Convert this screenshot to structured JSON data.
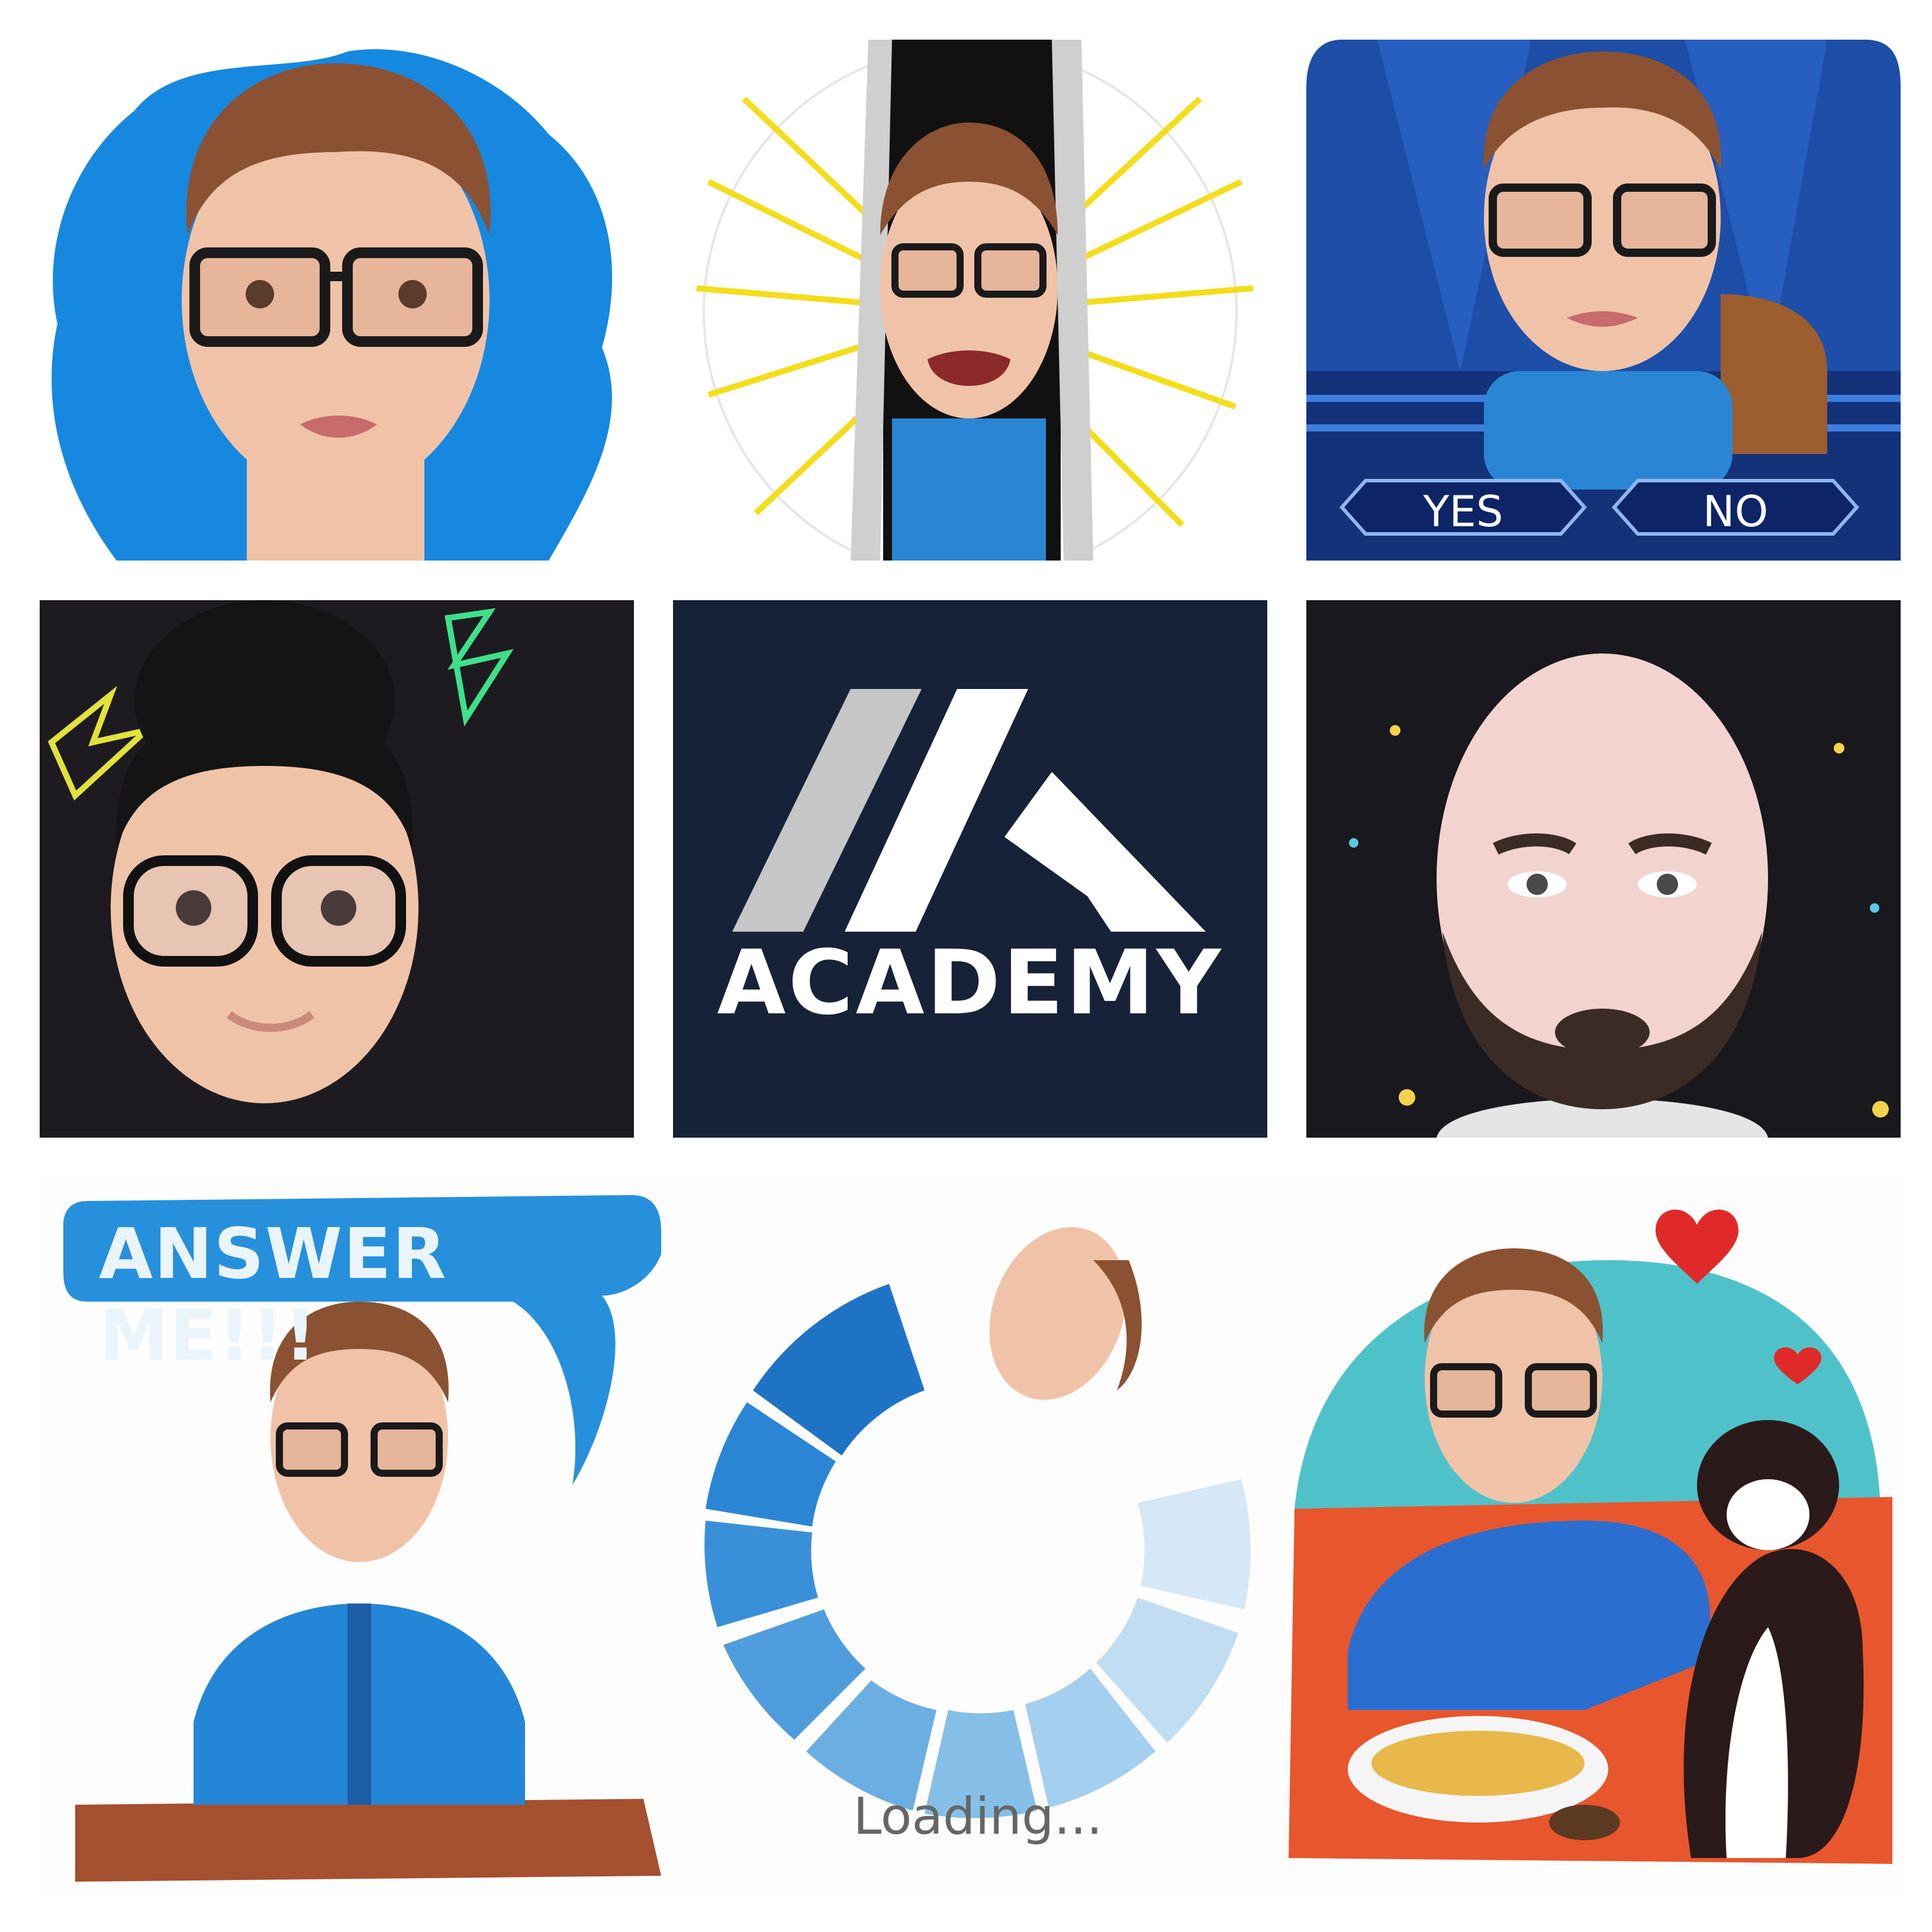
{
  "tiles": {
    "quiz": {
      "yes_label": "YES",
      "no_label": "NO"
    },
    "logo": {
      "text": "ACADEMY"
    },
    "answer": {
      "bubble_text": "ANSWER ME!!!"
    },
    "loading": {
      "text": "Loading..."
    }
  },
  "colors": {
    "blue_splash": "#1788e0",
    "quiz_bg": "#1d4fa8",
    "logo_bg": "#172239",
    "dark_bg": "#1d1b20",
    "skin": "#f0c3a8",
    "shirt_blue": "#2a86d4"
  }
}
